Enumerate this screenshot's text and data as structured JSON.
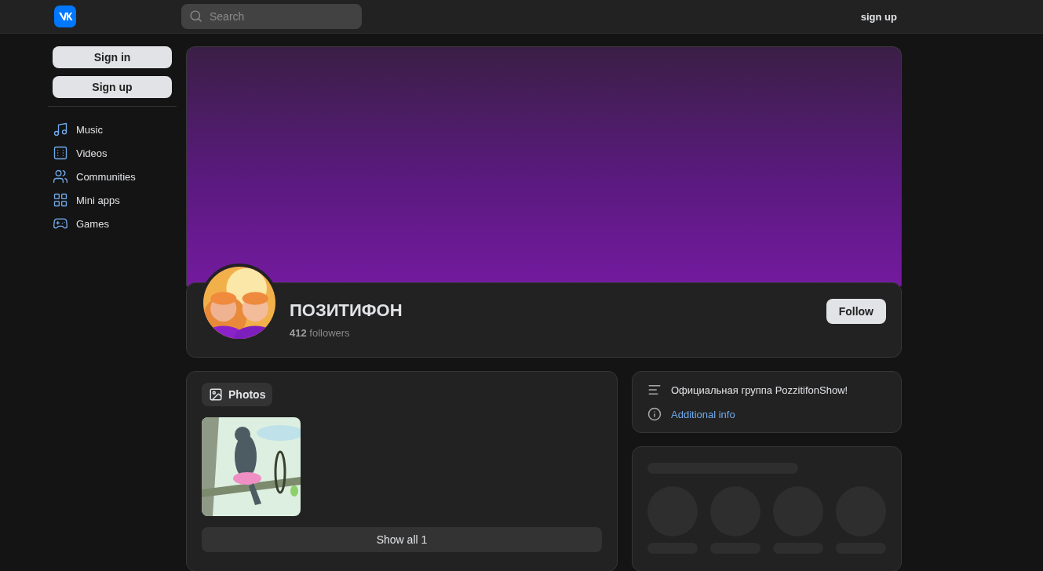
{
  "header": {
    "search": {
      "placeholder": "Search"
    },
    "signup_link": "sign up"
  },
  "sidebar": {
    "buttons": [
      "Sign in",
      "Sign up"
    ],
    "items": [
      {
        "label": "Music"
      },
      {
        "label": "Videos"
      },
      {
        "label": "Communities"
      },
      {
        "label": "Mini apps"
      },
      {
        "label": "Games"
      }
    ]
  },
  "community": {
    "name": "ПОЗИТИФОН",
    "followers_count": "412",
    "followers_label": "followers",
    "follow_button": "Follow"
  },
  "photos": {
    "title": "Photos",
    "show_all": "Show all 1"
  },
  "info": {
    "description": "Официальная группа PozzitifonShow!",
    "link": "Additional info"
  }
}
